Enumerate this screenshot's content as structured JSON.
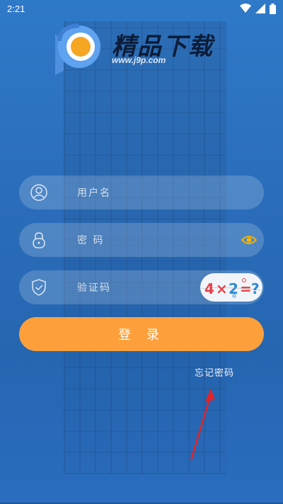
{
  "status_bar": {
    "time": "2:21",
    "icons": [
      "wifi-icon",
      "signal-icon",
      "battery-icon"
    ]
  },
  "logo": {
    "title": "精品下载",
    "url": "www.j9p.com"
  },
  "form": {
    "username": {
      "placeholder": "用户名",
      "value": "",
      "icon": "user-icon"
    },
    "password": {
      "placeholder": "密 码",
      "value": "",
      "icon": "lock-icon",
      "toggle_icon": "eye-icon"
    },
    "captcha": {
      "placeholder": "验证码",
      "value": "",
      "icon": "shield-icon",
      "image_text": "4×2=?"
    }
  },
  "login_button": {
    "label": "登 录"
  },
  "forgot_password": {
    "label": "忘记密码"
  },
  "colors": {
    "accent": "#fda03c",
    "background": "#2a6dba",
    "eye_icon": "#f4b400",
    "annotation_arrow": "#e0242a"
  }
}
